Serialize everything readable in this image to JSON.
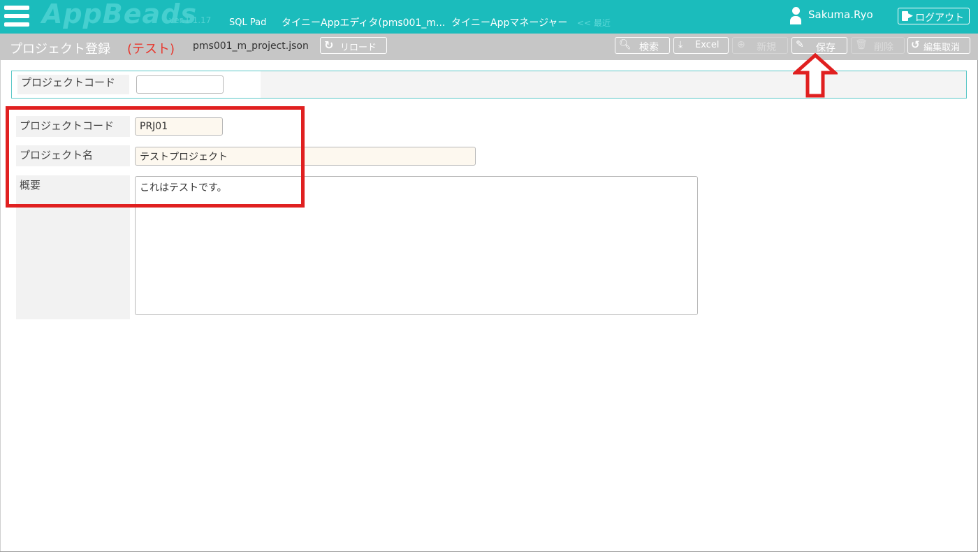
{
  "app": {
    "logo": "AppBeads",
    "version": "ver.1.1.17",
    "nav": [
      "SQL Pad",
      "タイニーAppエディタ(pms001_m...",
      "タイニーAppマネージャー"
    ],
    "recent": "<< 最近",
    "user": "Sakuma.Ryo",
    "logout_label": "ログアウト"
  },
  "toolbar": {
    "title": "プロジェクト登録",
    "title_tag": "(テスト)",
    "filename": "pms001_m_project.json",
    "reload_label": "リロード",
    "search_label": "検索",
    "excel_label": "Excel",
    "new_label": "新規",
    "save_label": "保存",
    "delete_label": "削除",
    "cancel_label": "編集取消"
  },
  "search": {
    "project_code_label": "プロジェクトコード",
    "project_code_value": ""
  },
  "form": {
    "project_code_label": "プロジェクトコード",
    "project_code_value": "PRJ01",
    "project_name_label": "プロジェクト名",
    "project_name_value": "テストプロジェクト",
    "summary_label": "概要",
    "summary_value": "これはテストです。"
  },
  "colors": {
    "topbar": "#1bbcbc",
    "subbar": "#c6c6c6",
    "highlight_red": "#e02020",
    "title_red": "#e8352b"
  }
}
